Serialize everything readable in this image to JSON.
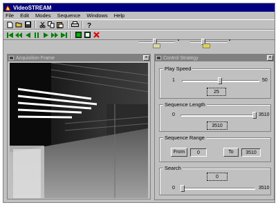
{
  "app": {
    "title": "VideoSTREAM",
    "menu": [
      "File",
      "Edit",
      "Modes",
      "Sequence",
      "Windows",
      "Help"
    ]
  },
  "toolbar1": {
    "icons": [
      "new-icon",
      "open-icon",
      "save-icon",
      "cut-icon",
      "copy-icon",
      "paste-icon",
      "print-icon",
      "help-icon"
    ]
  },
  "toolbar2": {
    "icons": [
      "first-frame-icon",
      "rewind-icon",
      "play-reverse-icon",
      "pause-icon",
      "play-icon",
      "fast-forward-icon",
      "last-frame-icon",
      "capture-icon",
      "record-icon",
      "stop-icon"
    ]
  },
  "viewer": {
    "title": "Acquisition Frame"
  },
  "panel": {
    "title": "Control Strategy",
    "play_speed": {
      "label": "Play Speed",
      "min": "1",
      "max": "50",
      "value": "25"
    },
    "sequence_length": {
      "label": "Sequence Length",
      "min": "0",
      "max": "3510",
      "value": "3510"
    },
    "sequence_range": {
      "label": "Sequence Range",
      "from_label": "From",
      "from_value": "0",
      "to_label": "To",
      "to_value": "3510"
    },
    "search": {
      "label": "Search",
      "value": "0",
      "min": "0",
      "max": "3510"
    }
  },
  "colors": {
    "titlebar": "#000080",
    "child_title": "#808080",
    "face": "#c0c0c0"
  }
}
